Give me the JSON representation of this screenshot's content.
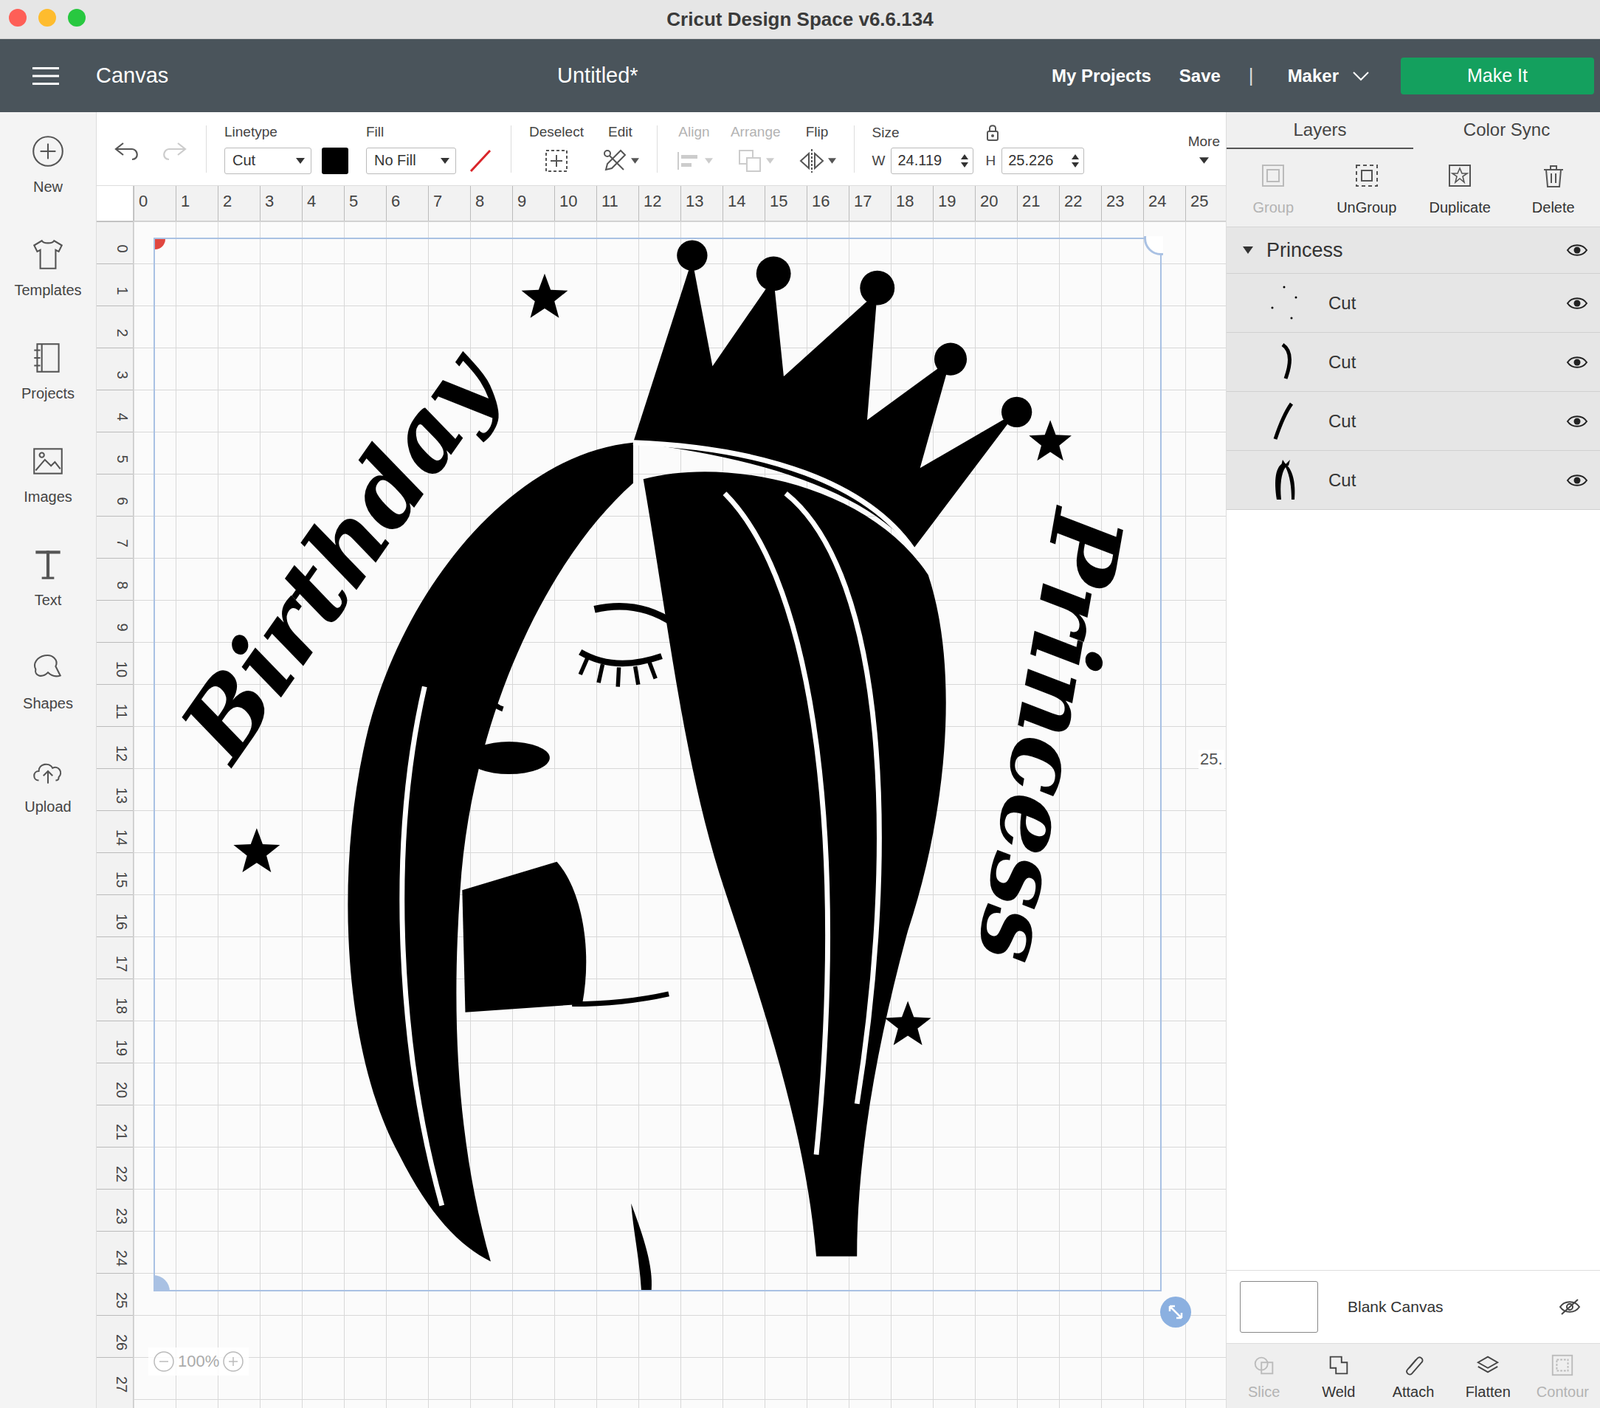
{
  "window": {
    "title": "Cricut Design Space  v6.6.134"
  },
  "nav": {
    "section": "Canvas",
    "document": "Untitled*",
    "links": [
      "My Projects",
      "Save"
    ],
    "separator": "|",
    "machine": "Maker",
    "make_it": "Make It"
  },
  "toolbar": {
    "linetype": {
      "label": "Linetype",
      "value": "Cut",
      "swatch": "#000000"
    },
    "fill": {
      "label": "Fill",
      "value": "No Fill"
    },
    "tools": [
      {
        "label": "Deselect",
        "disabled": false
      },
      {
        "label": "Edit",
        "disabled": false
      },
      {
        "label": "Align",
        "disabled": true
      },
      {
        "label": "Arrange",
        "disabled": true
      },
      {
        "label": "Flip",
        "disabled": false
      }
    ],
    "size": {
      "label": "Size",
      "w_label": "W",
      "w": "24.119",
      "h_label": "H",
      "h": "25.226",
      "locked": true
    },
    "more": "More"
  },
  "sidebar": {
    "items": [
      {
        "label": "New"
      },
      {
        "label": "Templates"
      },
      {
        "label": "Projects"
      },
      {
        "label": "Images"
      },
      {
        "label": "Text"
      },
      {
        "label": "Shapes"
      },
      {
        "label": "Upload"
      }
    ]
  },
  "rulers": {
    "horizontal": [
      "0",
      "1",
      "2",
      "3",
      "4",
      "5",
      "6",
      "7",
      "8",
      "9",
      "10",
      "11",
      "12",
      "13",
      "14",
      "15",
      "16",
      "17",
      "18",
      "19",
      "20",
      "21",
      "22",
      "23",
      "24",
      "25"
    ],
    "vertical": [
      "0",
      "1",
      "2",
      "3",
      "4",
      "5",
      "6",
      "7",
      "8",
      "9",
      "10",
      "11",
      "12",
      "13",
      "14",
      "15",
      "16",
      "17",
      "18",
      "19",
      "20",
      "21",
      "22",
      "23",
      "24",
      "25",
      "26",
      "27"
    ]
  },
  "canvas": {
    "artwork_texts": [
      "Birthday",
      "Princess"
    ],
    "dimension": "25.",
    "zoom": "100%"
  },
  "layers_panel": {
    "tabs": [
      {
        "label": "Layers",
        "selected": true
      },
      {
        "label": "Color Sync",
        "selected": false
      }
    ],
    "actions": [
      {
        "label": "Group",
        "disabled": true
      },
      {
        "label": "UnGroup",
        "disabled": false
      },
      {
        "label": "Duplicate",
        "disabled": false
      },
      {
        "label": "Delete",
        "disabled": false
      }
    ],
    "group": {
      "name": "Princess",
      "expanded": true,
      "visible": true
    },
    "layers": [
      {
        "label": "Cut",
        "visible": true
      },
      {
        "label": "Cut",
        "visible": true
      },
      {
        "label": "Cut",
        "visible": true
      },
      {
        "label": "Cut",
        "visible": true
      }
    ],
    "blank_canvas": {
      "label": "Blank Canvas",
      "visible": false
    },
    "bottom_actions": [
      {
        "label": "Slice",
        "disabled": true
      },
      {
        "label": "Weld",
        "disabled": false
      },
      {
        "label": "Attach",
        "disabled": false
      },
      {
        "label": "Flatten",
        "disabled": false
      },
      {
        "label": "Contour",
        "disabled": true
      }
    ]
  }
}
